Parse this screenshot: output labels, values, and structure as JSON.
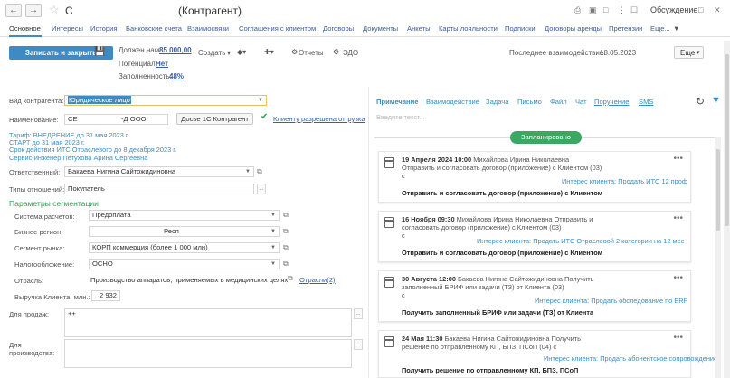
{
  "window": {
    "title_left": "С",
    "title_right": "(Контрагент)",
    "discussion_label": "Обсуждение"
  },
  "tabs": [
    "Основное",
    "Интересы",
    "История",
    "Банковские счета",
    "Взаимосвязи",
    "Соглашения с клиентом",
    "Договоры",
    "Документы",
    "Анкеты",
    "Карты лояльности",
    "Подписки",
    "Договоры аренды",
    "Претензии",
    "Еще..."
  ],
  "toolbar": {
    "save_close": "Записать и закрыть",
    "owes_label": "Должен нам:",
    "owes_value": "85 000,00",
    "potential_label": "Потенциал:",
    "potential_value": "Нет",
    "fill_label": "Заполненность:",
    "fill_value": "48%",
    "create": "Создать",
    "reports": "Отчеты",
    "edo": "ЭДО",
    "last_interaction_label": "Последнее взаимодействие:",
    "last_interaction_value": "18.05.2023",
    "more": "Еще"
  },
  "form": {
    "kind_label": "Вид контрагента:",
    "kind_value": "Юридическое лицо",
    "name_label": "Наименование:",
    "name_value1": "СЕ",
    "name_value2": "-Д ООО",
    "about_button": "Досье 1С Контрагент",
    "shipment_allowed": "Клиенту разрешена отгрузка",
    "info_lines": [
      "Тариф: ВНЕДРЕНИЕ до 31 мая 2023 г.",
      "СТАРТ до 31 мая 2023 г.",
      "Срок действия ИТС Отраслевого до 8 декабря 2023 г.",
      "Сервис-инженер Петухова Арина Сергеевна"
    ],
    "responsible_label": "Ответственный:",
    "responsible_value": "Бакаева Нигина Сайтожидиновна",
    "relation_label": "Типы отношений:",
    "relation_value": "Покупатель",
    "segmentation_title": "Параметры сегментации",
    "segmentation": [
      {
        "label": "Система расчетов:",
        "value": "Предоплата"
      },
      {
        "label": "Бизнес-регион:",
        "value": "Респ"
      },
      {
        "label": "Сегмент рынка:",
        "value": "КОРП коммерция (более 1 000 млн)"
      },
      {
        "label": "Налогообложение:",
        "value": "ОСНО"
      },
      {
        "label": "Отрасль:",
        "value": "Производство аппаратов, применяемых в медицинских целях,"
      }
    ],
    "industries_link": "Отрасли(2)",
    "revenue_label": "Выручка Клиента, млн.:",
    "revenue_value": "2 932",
    "for_sales_label": "Для продаж:",
    "for_sales_value": "++",
    "for_production_label1": "Для",
    "for_production_label2": "производства:"
  },
  "right": {
    "tabs": [
      "Примечание",
      "Взаимодействие",
      "Задача",
      "Письмо",
      "Файл",
      "Чат",
      "Поручение",
      "SMS"
    ],
    "input_placeholder": "Введите текст...",
    "planned": "Запланировано",
    "cards": [
      {
        "date": "19 Апреля 2024 10:00",
        "text": "Михайлова Ирина Николаевна",
        "line2": "Отправить и согласовать договор (приложение) с Клиентом (03)",
        "line3": "с",
        "interest": "Интерес клиента: Продать ИТС 12 проф",
        "subject": "Отправить и согласовать договор (приложение) с Клиентом"
      },
      {
        "date": "16 Ноября 09:30",
        "text": "Михайлова Ирина Николаевна Отправить и",
        "line2": "согласовать договор (приложение) с Клиентом (03)",
        "line3": "с",
        "interest": "Интерес клиента: Продать ИТС Отраслевой 2 категории на 12 мес",
        "subject": "Отправить и согласовать договор (приложение) с Клиентом"
      },
      {
        "date": "30 Августа 12:00",
        "text": "Бакаева Нигина Сайтожидиновна Получить",
        "line2": "заполненный БРИФ или задачи (ТЗ) от Клиента (03)",
        "line3": "с",
        "interest": "Интерес клиента: Продать обследование по ERP",
        "subject": "Получить заполненный БРИФ или задачи (ТЗ) от Клиента"
      },
      {
        "date": "24 Мая 11:30",
        "text": "Бакаева Нигина Сайтожидиновна Получить",
        "line2": "решение по отправленному КП, БПЗ, ПСоП (04) с",
        "line3": "",
        "interest": "Интерес клиента: Продать абонентское сопровождение",
        "subject": "Получить решение по отправленному КП, БПЗ, ПСоП"
      }
    ]
  }
}
